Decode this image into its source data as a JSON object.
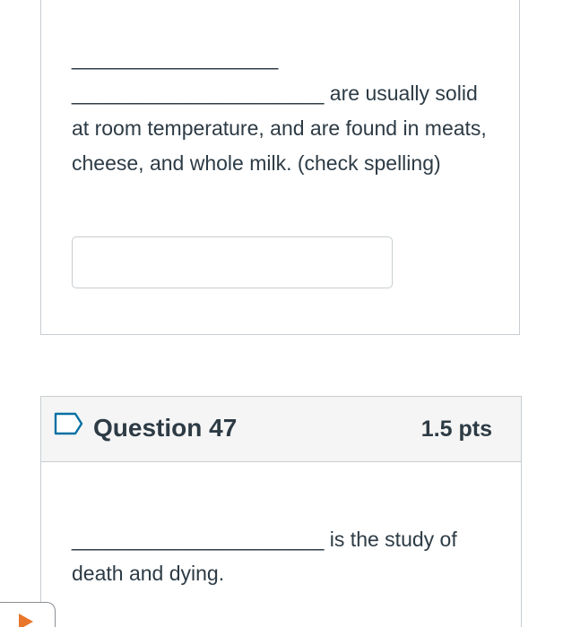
{
  "question_1": {
    "blank_line_1": "__________________",
    "blank_line_2": "______________________",
    "text_after_blank": " are usually solid at room temperature, and are found in meats, cheese, and whole milk. (check spelling)",
    "answer_value": "",
    "answer_placeholder": ""
  },
  "question_2": {
    "title": "Question 47",
    "points": "1.5 pts",
    "flag_icon": "bookmark-flag-icon",
    "blank_line": "______________________",
    "text_after_blank": " is the study of death and dying."
  },
  "nav": {
    "icon": "play-icon",
    "accent": "#e8762b"
  },
  "colors": {
    "text": "#2d3b45",
    "border": "#c7cdd1",
    "header_bg": "#f5f5f5"
  }
}
